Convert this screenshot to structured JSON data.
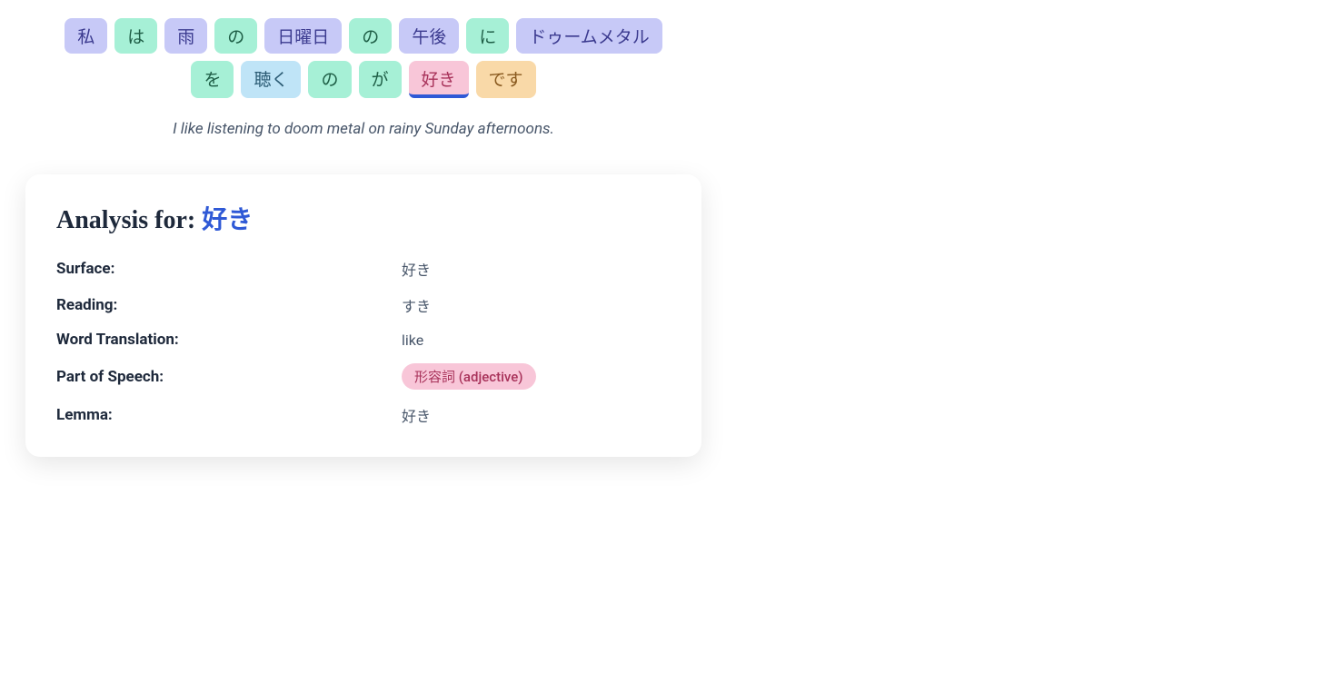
{
  "tokens": [
    {
      "text": "私",
      "cls": "noun"
    },
    {
      "text": "は",
      "cls": "particle"
    },
    {
      "text": "雨",
      "cls": "noun"
    },
    {
      "text": "の",
      "cls": "particle"
    },
    {
      "text": "日曜日",
      "cls": "noun"
    },
    {
      "text": "の",
      "cls": "particle"
    },
    {
      "text": "午後",
      "cls": "noun"
    },
    {
      "text": "に",
      "cls": "particle"
    },
    {
      "text": "ドゥームメタル",
      "cls": "noun"
    },
    {
      "text": "を",
      "cls": "particle"
    },
    {
      "text": "聴く",
      "cls": "verb"
    },
    {
      "text": "の",
      "cls": "particle"
    },
    {
      "text": "が",
      "cls": "particle"
    },
    {
      "text": "好き",
      "cls": "adjective",
      "selected": true
    },
    {
      "text": "です",
      "cls": "aux"
    }
  ],
  "translation": "I like listening to doom metal on rainy Sunday afternoons.",
  "analysis": {
    "heading_prefix": "Analysis for: ",
    "heading_word": "好き",
    "labels": {
      "surface": "Surface:",
      "reading": "Reading:",
      "word_translation": "Word Translation:",
      "pos": "Part of Speech:",
      "lemma": "Lemma:"
    },
    "values": {
      "surface": "好き",
      "reading": "すき",
      "word_translation": "like",
      "pos": "形容詞 (adjective)",
      "lemma": "好き"
    }
  }
}
